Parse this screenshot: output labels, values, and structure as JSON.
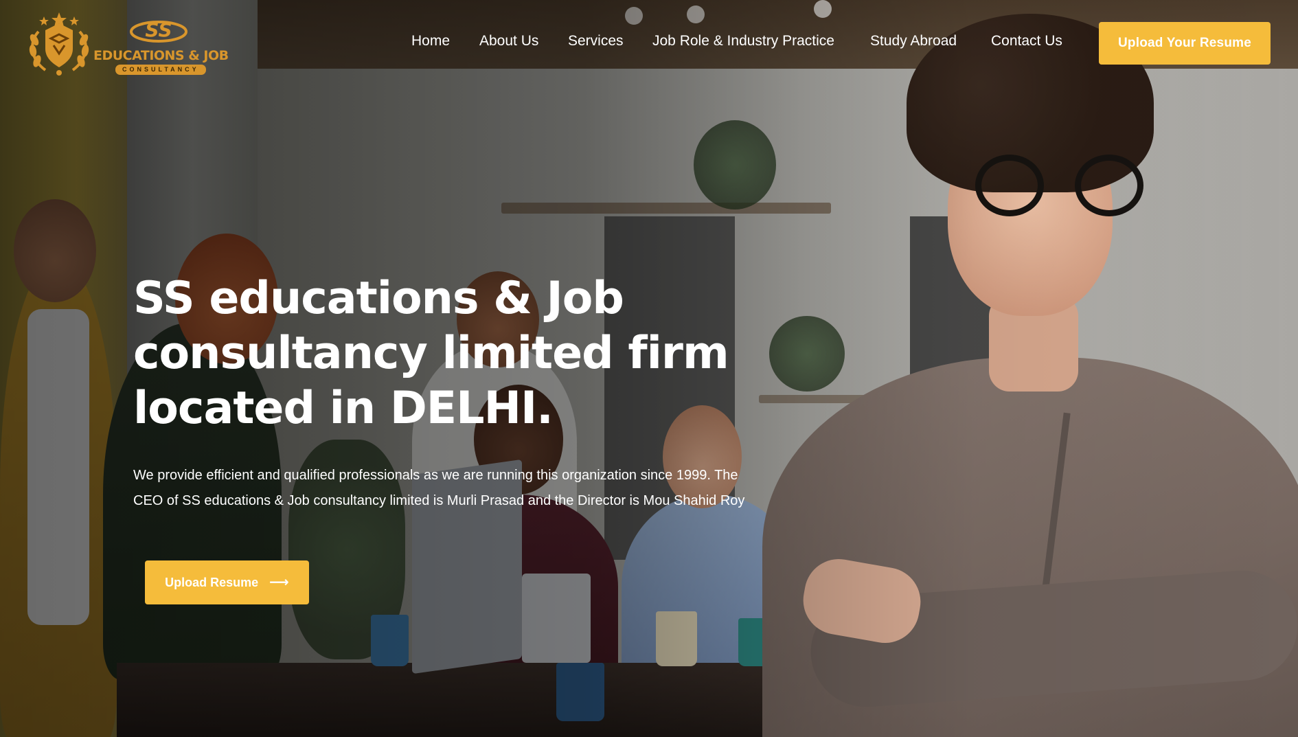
{
  "brand": {
    "logo_title": "EDUCATIONS & JOB",
    "logo_subtitle": "CONSULTANCY",
    "logo_monogram": "SS",
    "accent_color": "#f5bc3b",
    "logo_color": "#d9962c"
  },
  "nav": {
    "items": [
      {
        "label": "Home"
      },
      {
        "label": "About Us"
      },
      {
        "label": "Services"
      },
      {
        "label": "Job Role & Industry Practice"
      },
      {
        "label": "Study Abroad"
      },
      {
        "label": "Contact Us"
      }
    ],
    "cta_label": "Upload Your Resume"
  },
  "hero": {
    "headline_lines": [
      "SS educations & Job",
      "consultancy limited firm",
      "located in DELHI."
    ],
    "description": "We provide efficient and qualified professionals as we are running this organization since 1999. The CEO of SS educations & Job consultancy limited is Murli Prasad and the Director is Mou Shahid Roy",
    "cta_label": "Upload Resume",
    "cta_icon": "arrow-right-icon"
  }
}
